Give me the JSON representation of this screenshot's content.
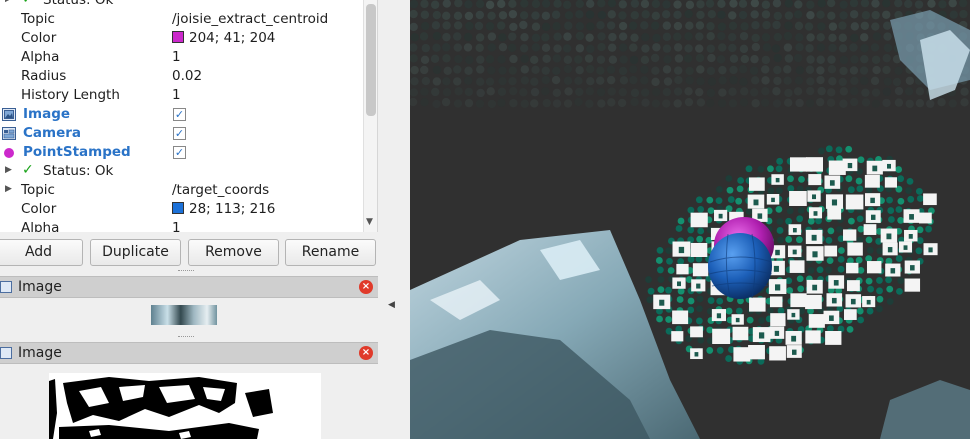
{
  "tree": {
    "rows": [
      {
        "type": "status",
        "text": "Status: Ok"
      },
      {
        "type": "prop",
        "key": "Topic",
        "value": "/joisie_extract_centroid"
      },
      {
        "type": "color",
        "key": "Color",
        "value": "204; 41; 204",
        "swatch": "#cc29cc"
      },
      {
        "type": "prop",
        "key": "Alpha",
        "value": "1"
      },
      {
        "type": "prop",
        "key": "Radius",
        "value": "0.02"
      },
      {
        "type": "prop",
        "key": "History Length",
        "value": "1"
      },
      {
        "type": "display",
        "key": "Image",
        "checked": true,
        "icon": "image-icon"
      },
      {
        "type": "display",
        "key": "Camera",
        "checked": true,
        "icon": "camera-icon"
      },
      {
        "type": "display",
        "key": "PointStamped",
        "checked": true,
        "icon": "point-icon",
        "icon_color": "#cc29cc"
      },
      {
        "type": "status",
        "text": "Status: Ok"
      },
      {
        "type": "prop",
        "key": "Topic",
        "value": "/target_coords"
      },
      {
        "type": "color",
        "key": "Color",
        "value": "28; 113; 216",
        "swatch": "#1c71d8"
      },
      {
        "type": "prop",
        "key": "Alpha",
        "value": "1"
      }
    ]
  },
  "buttons": {
    "add": "Add",
    "duplicate": "Duplicate",
    "remove": "Remove",
    "rename": "Rename"
  },
  "panels": [
    {
      "title": "Image"
    },
    {
      "title": "Image"
    }
  ],
  "colors": {
    "accent": "#2a73c7",
    "status_ok": "#19a319",
    "view_background": "#303030",
    "marker_magenta": "#cc29cc",
    "marker_blue": "#1c71d8"
  }
}
